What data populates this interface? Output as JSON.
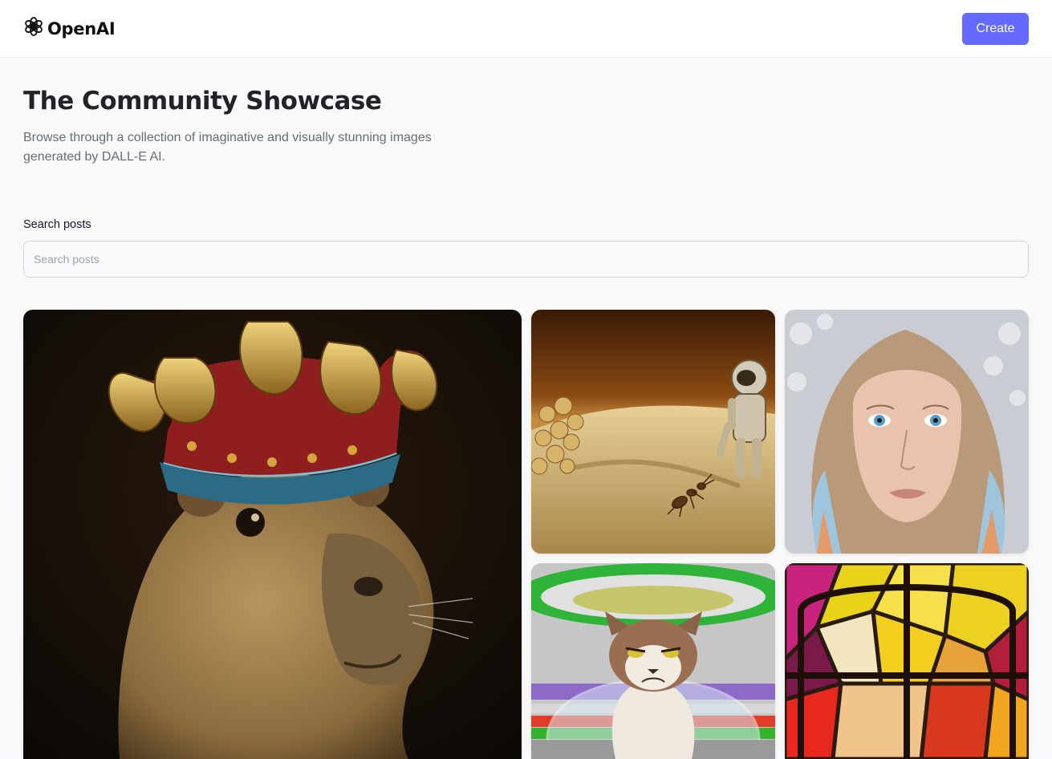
{
  "header": {
    "logo_text": "OpenAI",
    "logo_icon": "openai-logo-icon",
    "create_label": "Create",
    "accent_color": "#6469ff"
  },
  "hero": {
    "title": "The Community Showcase",
    "subtitle": "Browse through a collection of imaginative and visually stunning images generated by DALL-E AI."
  },
  "search": {
    "label": "Search posts",
    "placeholder": "Search posts",
    "value": ""
  },
  "gallery": {
    "items": [
      {
        "subject": "capybara wearing a jeweled crown"
      },
      {
        "subject": "astronaut and ant on sandy terrain"
      },
      {
        "subject": "portrait of a woman with blue eyes"
      },
      {
        "subject": "grumpy cat under a glass dome"
      },
      {
        "subject": "stained glass window"
      }
    ]
  }
}
